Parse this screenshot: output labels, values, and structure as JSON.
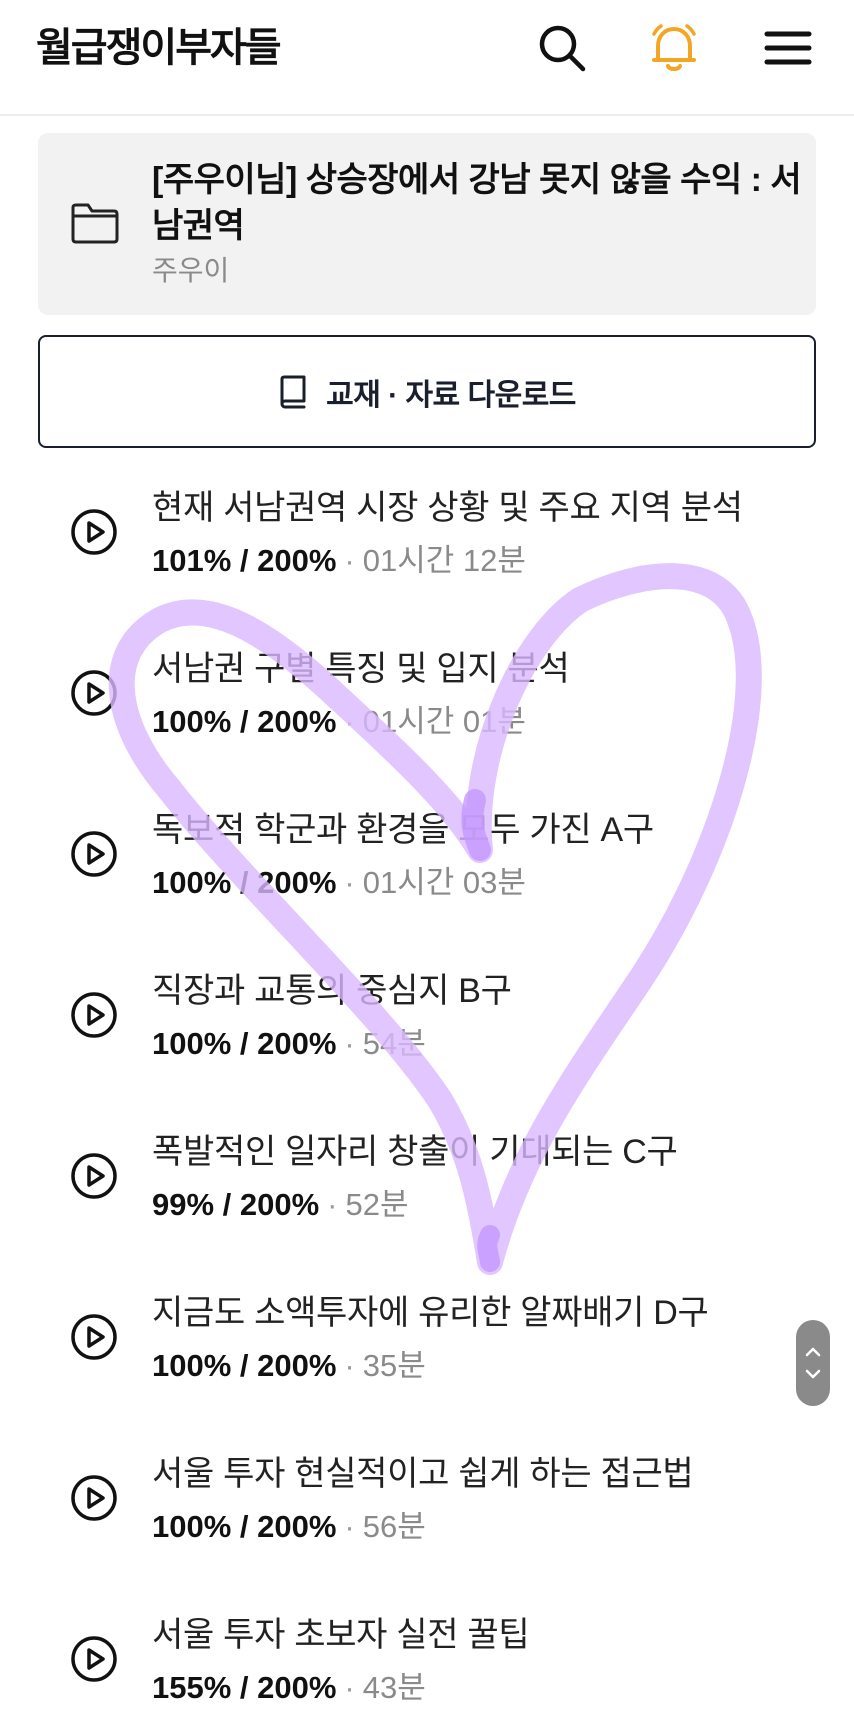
{
  "header": {
    "logo": "월급쟁이부자들",
    "icons": [
      "search-icon",
      "bell-icon",
      "menu-icon"
    ],
    "bell_color": "#f5a524"
  },
  "course": {
    "title": "[주우이님] 상승장에서 강남 못지 않을 수익 : 서남권역",
    "author": "주우이",
    "icon": "folder-icon"
  },
  "download": {
    "label": "교재 · 자료 다운로드",
    "icon": "book-icon",
    "color": "#1a1f2e"
  },
  "lessons": [
    {
      "title": "현재 서남권역 시장 상황 및 주요 지역 분석",
      "progress": "101% / 200%",
      "duration": "01시간 12분"
    },
    {
      "title": "서남권 구별 특징 및 입지 분석",
      "progress": "100% / 200%",
      "duration": "01시간 01분"
    },
    {
      "title": "독보적 학군과 환경을 모두 가진 A구",
      "progress": "100% / 200%",
      "duration": "01시간 03분"
    },
    {
      "title": "직장과 교통의 중심지 B구",
      "progress": "100% / 200%",
      "duration": "54분"
    },
    {
      "title": "폭발적인 일자리 창출이 기대되는 C구",
      "progress": "99% / 200%",
      "duration": "52분"
    },
    {
      "title": "지금도 소액투자에 유리한 알짜배기 D구",
      "progress": "100% / 200%",
      "duration": "35분"
    },
    {
      "title": "서울 투자 현실적이고 쉽게 하는 접근법",
      "progress": "100% / 200%",
      "duration": "56분"
    },
    {
      "title": "서울 투자 초보자 실전 꿀팁",
      "progress": "155% / 200%",
      "duration": "43분"
    }
  ],
  "meta_separator": "·",
  "overlay": {
    "icon": "heart-drawing",
    "color": "#d9b8ff"
  },
  "scroll": {
    "icons": [
      "chevron-up-icon",
      "chevron-down-icon"
    ]
  }
}
